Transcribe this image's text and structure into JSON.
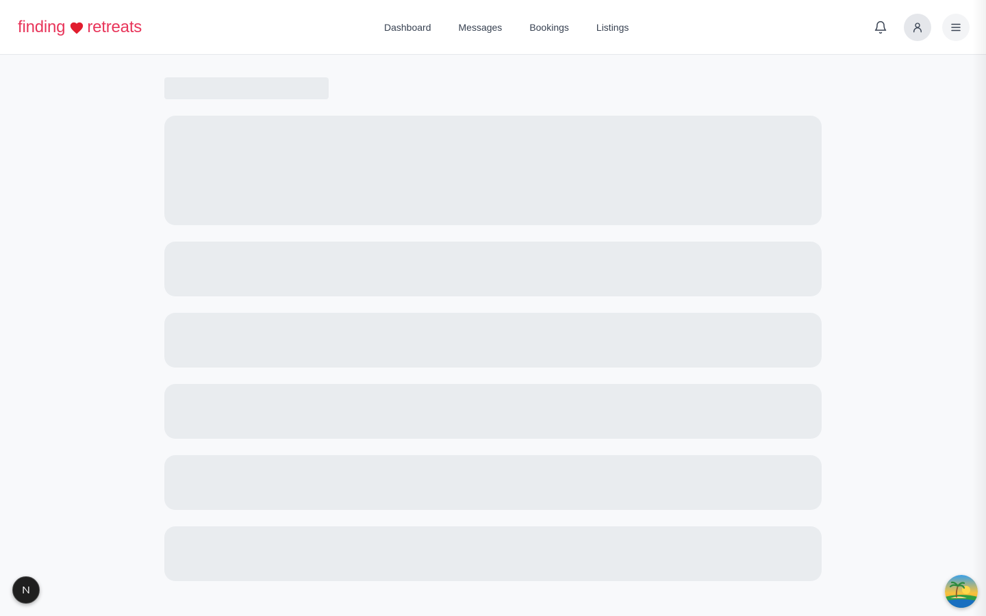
{
  "brand": {
    "name_left": "finding",
    "name_right": "retreats",
    "color": "#e8355a",
    "heart_color": "#e11d2e"
  },
  "nav": {
    "items": [
      {
        "label": "Dashboard"
      },
      {
        "label": "Messages"
      },
      {
        "label": "Bookings"
      },
      {
        "label": "Listings"
      }
    ]
  },
  "header_actions": {
    "icons": [
      "bell-icon",
      "user-icon",
      "hamburger-menu-icon"
    ]
  },
  "main": {
    "state": "loading",
    "skeleton_placeholders": 7
  },
  "overlays": {
    "dev_badge_letter": "N",
    "corner_badge_icon": "beach-island-icon"
  },
  "colors": {
    "page_bg": "#f8f9fb",
    "skeleton": "#e9ecef",
    "header_border": "#e5e7eb"
  }
}
